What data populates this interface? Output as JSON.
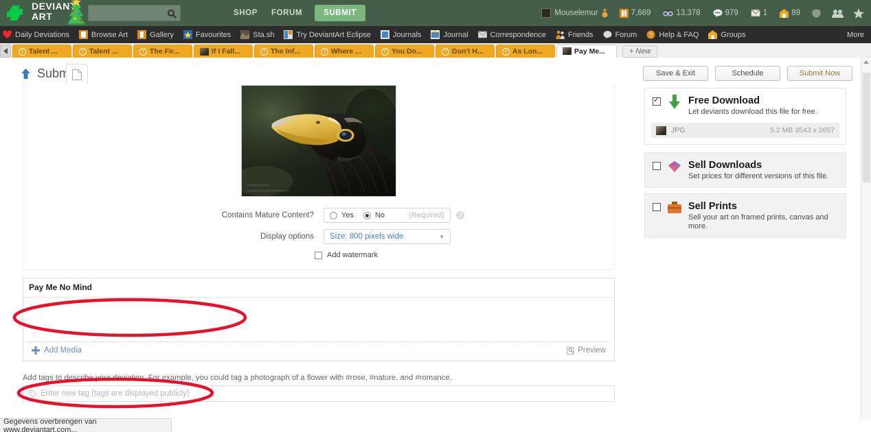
{
  "header": {
    "logo_line1": "DEVIANT",
    "logo_line2": "ART",
    "search_placeholder": "",
    "search_icon": "search-icon",
    "shop": "SHOP",
    "forum": "FORUM",
    "submit": "SUBMIT",
    "user": {
      "name": "Mouselemur",
      "avatar": "avatar-icon",
      "badge": "medal-icon"
    },
    "stats": [
      {
        "icon": "points-icon",
        "value": "7,669"
      },
      {
        "icon": "watchers-icon",
        "value": "13,378"
      },
      {
        "icon": "comments-icon",
        "value": "979"
      },
      {
        "icon": "messages-icon",
        "value": "1"
      },
      {
        "icon": "notes-icon",
        "value": "89"
      }
    ],
    "trailing_icons": [
      "shield-icon",
      "friends-icon",
      "star-icon"
    ]
  },
  "nav": {
    "items": [
      {
        "label": "Daily Deviations",
        "icon": "heart-icon"
      },
      {
        "label": "Browse Art",
        "icon": "browse-icon"
      },
      {
        "label": "Gallery",
        "icon": "gallery-icon"
      },
      {
        "label": "Favourites",
        "icon": "star-icon"
      },
      {
        "label": "Sta.sh",
        "icon": "stash-icon"
      },
      {
        "label": "Try DeviantArt Eclipse",
        "icon": "eclipse-icon"
      },
      {
        "label": "Journals",
        "icon": "journal-icon"
      },
      {
        "label": "Journal",
        "icon": "journal-icon"
      },
      {
        "label": "Correspondence",
        "icon": "mail-icon"
      },
      {
        "label": "Friends",
        "icon": "friends-icon"
      },
      {
        "label": "Forum",
        "icon": "forum-icon"
      },
      {
        "label": "Help & FAQ",
        "icon": "help-icon"
      },
      {
        "label": "Groups",
        "icon": "groups-icon"
      }
    ],
    "more": "More"
  },
  "tabstrip": {
    "scroll_left_icon": "chevron-left-icon",
    "tabs": [
      {
        "label": "Talent ...",
        "icon": "clock-icon",
        "active": false
      },
      {
        "label": "Talent ...",
        "icon": "clock-icon",
        "active": false
      },
      {
        "label": "The Fir...",
        "icon": "clock-icon",
        "active": false
      },
      {
        "label": "If I Fall...",
        "icon": "thumb-icon",
        "active": false
      },
      {
        "label": "The Inf...",
        "icon": "clock-icon",
        "active": false
      },
      {
        "label": "Where ...",
        "icon": "clock-icon",
        "active": false
      },
      {
        "label": "You Do...",
        "icon": "clock-icon",
        "active": false
      },
      {
        "label": "Don't H...",
        "icon": "clock-icon",
        "active": false
      },
      {
        "label": "As Lon...",
        "icon": "clock-icon",
        "active": false
      },
      {
        "label": "Pay Me...",
        "icon": "thumb-icon",
        "active": true
      }
    ],
    "new_tab": "New",
    "close_icon": "close-icon"
  },
  "toolbar": {
    "title": "Submit",
    "upload_icon": "up-arrow-icon",
    "page_icon": "page-icon",
    "save_exit": "Save & Exit",
    "schedule": "Schedule",
    "submit_now": "Submit Now"
  },
  "form": {
    "mature_label": "Contains Mature Content?",
    "mature_yes": "Yes",
    "mature_no": "No",
    "mature_required": "(Required)",
    "mature_selected": "No",
    "help_icon": "question-icon",
    "display_label": "Display options",
    "display_value": "Size: 800 pixels wide",
    "watermark_label": "Add watermark",
    "watermark_checked": false
  },
  "description": {
    "title": "Pay Me No Mind",
    "body": "",
    "add_media": "Add Media",
    "add_media_icon": "plus-icon",
    "preview": "Preview",
    "preview_icon": "magnifier-icon"
  },
  "tags": {
    "help": "Add tags to describe your deviation. For example, you could tag a photograph of a flower with #rose, #nature, and #romance.",
    "placeholder": "Enter new tag (tags are displayed publicly)",
    "tag_icon": "tag-icon",
    "value": ""
  },
  "sidebar": {
    "free_download": {
      "title": "Free Download",
      "subtitle": "Let deviants download this file for free.",
      "checked": true,
      "icon": "download-arrow-icon",
      "file": {
        "type": "JPG",
        "meta": "5.2 MB  3543 x 2657"
      }
    },
    "sell_downloads": {
      "title": "Sell Downloads",
      "subtitle": "Set prices for different versions of this file.",
      "checked": false,
      "icon": "gem-icon"
    },
    "sell_prints": {
      "title": "Sell Prints",
      "subtitle": "Sell your art on framed prints, canvas and more.",
      "checked": false,
      "icon": "briefcase-icon"
    }
  },
  "statusbar": {
    "text": "Gegevens overbrengen van www.deviantart.com..."
  },
  "colors": {
    "header_green": "#445e49",
    "nav_dark": "#2c2c2c",
    "tab_orange": "#efa81f",
    "submit_green": "#7ab87f",
    "annotation_red": "#e8102a",
    "link_blue": "#4a80c4"
  },
  "annotations": [
    {
      "shape": "ellipse",
      "target": "description-body",
      "color": "#e8102a"
    },
    {
      "shape": "ellipse",
      "target": "tag-input",
      "color": "#e8102a"
    }
  ]
}
